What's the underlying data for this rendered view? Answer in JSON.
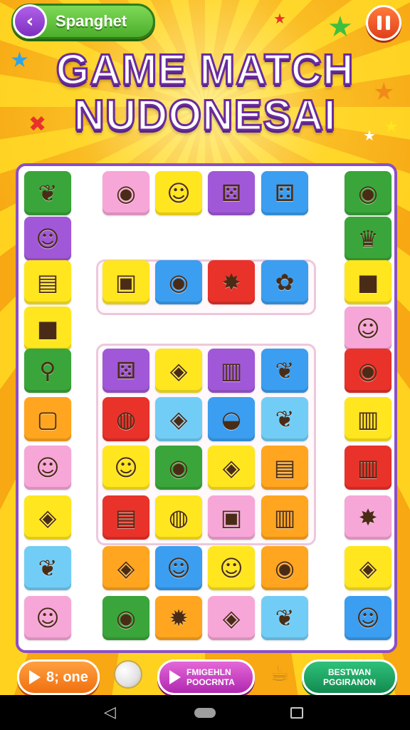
{
  "header": {
    "back_label": "Spanghet",
    "back_icon": "chevron-left-icon",
    "pause_icon": "pause-icon"
  },
  "title": {
    "line1": "GAME MATCH",
    "line2": "NUDONESAI"
  },
  "colors": {
    "purple": "#a058d8",
    "pink": "#f7a6d8",
    "yellow": "#ffe61f",
    "blue": "#3b9ef0",
    "green": "#3aa53a",
    "red": "#e8322a",
    "orange": "#ffa51f",
    "lightblue": "#72cdf6",
    "board_border": "#8c4fc4"
  },
  "board": {
    "rows": [
      [
        {
          "color": "green",
          "icon": "leaf-icon",
          "glyph": "❦"
        },
        null,
        {
          "color": "pink",
          "icon": "planet-icon",
          "glyph": "◉"
        },
        {
          "color": "yellow",
          "icon": "cat-face-icon",
          "glyph": "☺"
        },
        {
          "color": "purple",
          "icon": "dice-cube-icon",
          "glyph": "⚄"
        },
        {
          "color": "blue",
          "icon": "dice-cube-icon",
          "glyph": "⚃"
        },
        null,
        {
          "color": "green",
          "icon": "planet-icon",
          "glyph": "◉"
        }
      ],
      [
        {
          "color": "purple",
          "icon": "cat-face-icon",
          "glyph": "☺"
        },
        null,
        null,
        null,
        null,
        null,
        null,
        {
          "color": "green",
          "icon": "crown-icon",
          "glyph": "♛"
        }
      ],
      [
        {
          "color": "yellow",
          "icon": "book-heart-icon",
          "glyph": "▤"
        },
        null,
        {
          "color": "yellow",
          "icon": "camera-icon",
          "glyph": "▣"
        },
        {
          "color": "blue",
          "icon": "planet-icon",
          "glyph": "◉"
        },
        {
          "color": "red",
          "icon": "magic-lamp-icon",
          "glyph": "✸"
        },
        {
          "color": "blue",
          "icon": "fish-icon",
          "glyph": "✿"
        },
        null,
        {
          "color": "yellow",
          "icon": "cube-icon",
          "glyph": "■"
        }
      ],
      [
        {
          "color": "yellow",
          "icon": "cube-icon",
          "glyph": "■"
        },
        null,
        null,
        null,
        null,
        null,
        null,
        {
          "color": "pink",
          "icon": "cat-face-icon",
          "glyph": "☺"
        }
      ],
      [
        {
          "color": "green",
          "icon": "magnifier-icon",
          "glyph": "⚲"
        },
        null,
        {
          "color": "purple",
          "icon": "dice-cube-icon",
          "glyph": "⚄"
        },
        {
          "color": "yellow",
          "icon": "potion-tube-icon",
          "glyph": "◈"
        },
        {
          "color": "purple",
          "icon": "treasure-chest-icon",
          "glyph": "▥"
        },
        {
          "color": "blue",
          "icon": "leaf-icon",
          "glyph": "❦"
        },
        null,
        {
          "color": "red",
          "icon": "planet-icon",
          "glyph": "◉"
        }
      ],
      [
        {
          "color": "orange",
          "icon": "chat-box-icon",
          "glyph": "▢"
        },
        null,
        {
          "color": "red",
          "icon": "rocket-icon",
          "glyph": "◍"
        },
        {
          "color": "lightblue",
          "icon": "potion-tube-icon",
          "glyph": "◈"
        },
        {
          "color": "blue",
          "icon": "bowl-icon",
          "glyph": "◒"
        },
        {
          "color": "lightblue",
          "icon": "leaf-icon",
          "glyph": "❦"
        },
        null,
        {
          "color": "yellow",
          "icon": "treasure-chest-icon",
          "glyph": "▥"
        }
      ],
      [
        {
          "color": "pink",
          "icon": "cat-face-icon",
          "glyph": "☺"
        },
        null,
        {
          "color": "yellow",
          "icon": "cat-face-icon",
          "glyph": "☺"
        },
        {
          "color": "green",
          "icon": "planet-icon",
          "glyph": "◉"
        },
        {
          "color": "yellow",
          "icon": "potion-tube-icon",
          "glyph": "◈"
        },
        {
          "color": "orange",
          "icon": "book-stack-icon",
          "glyph": "▤"
        },
        null,
        {
          "color": "red",
          "icon": "treasure-chest-icon",
          "glyph": "▥"
        }
      ],
      [
        {
          "color": "yellow",
          "icon": "potion-tube-icon",
          "glyph": "◈"
        },
        null,
        {
          "color": "red",
          "icon": "book-stack-icon",
          "glyph": "▤"
        },
        {
          "color": "yellow",
          "icon": "rocket-icon",
          "glyph": "◍"
        },
        {
          "color": "pink",
          "icon": "camera-icon",
          "glyph": "▣"
        },
        {
          "color": "orange",
          "icon": "treasure-chest-icon",
          "glyph": "▥"
        },
        null,
        {
          "color": "pink",
          "icon": "magic-lamp-icon",
          "glyph": "✸"
        }
      ],
      [
        {
          "color": "lightblue",
          "icon": "leaf-icon",
          "glyph": "❦"
        },
        null,
        {
          "color": "orange",
          "icon": "potion-tube-icon",
          "glyph": "◈"
        },
        {
          "color": "blue",
          "icon": "cat-face-icon",
          "glyph": "☺"
        },
        {
          "color": "yellow",
          "icon": "strawberry-icon",
          "glyph": "☺"
        },
        {
          "color": "orange",
          "icon": "planet-icon",
          "glyph": "◉"
        },
        null,
        {
          "color": "yellow",
          "icon": "potion-tube-icon",
          "glyph": "◈"
        }
      ],
      [
        {
          "color": "pink",
          "icon": "cat-face-icon",
          "glyph": "☺"
        },
        null,
        {
          "color": "green",
          "icon": "planet-icon",
          "glyph": "◉"
        },
        {
          "color": "orange",
          "icon": "sun-gear-icon",
          "glyph": "✹"
        },
        {
          "color": "pink",
          "icon": "potion-tube-icon",
          "glyph": "◈"
        },
        {
          "color": "lightblue",
          "icon": "leaf-icon",
          "glyph": "❦"
        },
        null,
        {
          "color": "blue",
          "icon": "cat-face-icon",
          "glyph": "☺"
        }
      ]
    ]
  },
  "footer": {
    "left_label": "8; one",
    "middle_line1": "FMIGEHLN",
    "middle_line2": "POOCRNTA",
    "right_line1": "BESTWAN",
    "right_line2": "PGGIRANON"
  }
}
